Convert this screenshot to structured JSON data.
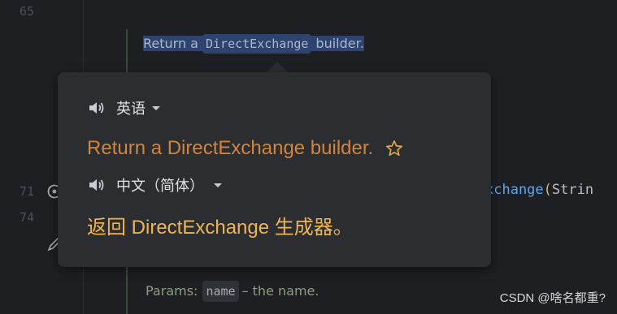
{
  "gutter": {
    "line_numbers": [
      "65",
      "71",
      "74"
    ]
  },
  "editor": {
    "doc_line": {
      "text_before": "Return a",
      "code": "DirectExchange",
      "text_after": "builder."
    },
    "code_fragment": {
      "method_tail": "xchange",
      "paren": "(",
      "param_type": "Strin"
    },
    "params_line": {
      "label": "Params:",
      "param": "name",
      "desc": "– the name."
    }
  },
  "translate_popup": {
    "source_lang": "英语",
    "source_text": "Return a DirectExchange builder.",
    "target_lang": "中文（简体）",
    "target_text": "返回 DirectExchange 生成器。"
  },
  "watermark": "CSDN @啥名都重?"
}
